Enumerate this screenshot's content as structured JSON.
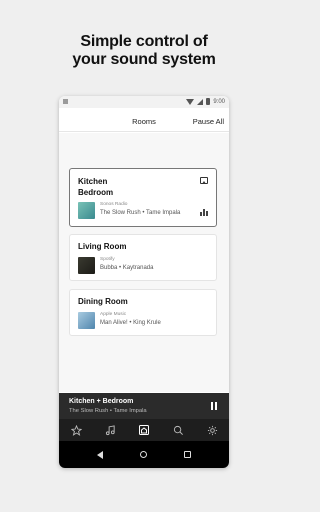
{
  "headline": {
    "line1": "Simple control of",
    "line2": "your sound system"
  },
  "status_bar": {
    "time": "9:00"
  },
  "header": {
    "title": "Rooms",
    "pause_all": "Pause All"
  },
  "rooms": [
    {
      "name_line1": "Kitchen",
      "name_line2": "Bedroom",
      "service": "Sonos Radio",
      "track": "The Slow Rush • Tame Impala",
      "selected": true,
      "art_color": "#4fa7a0"
    },
    {
      "name_line1": "Living Room",
      "service": "Spotify",
      "track": "Bubba • Kaytranada",
      "selected": false,
      "art_color": "#2b2a24"
    },
    {
      "name_line1": "Dining Room",
      "service": "Apple Music",
      "track": "Man Alive! • King Krule",
      "selected": false,
      "art_color": "#6e9fc0"
    }
  ],
  "now_playing": {
    "title": "Kitchen + Bedroom",
    "track": "The Slow Rush • Tame Impala"
  },
  "tab_bar": {
    "items": [
      "star-icon",
      "music-note-icon",
      "home-speaker-icon",
      "search-icon",
      "gear-icon"
    ],
    "active": "home-speaker-icon"
  },
  "colors": {
    "background": "#efefef",
    "now_playing_bar": "#2b2b2b",
    "tab_bar": "#1e1e1e"
  }
}
